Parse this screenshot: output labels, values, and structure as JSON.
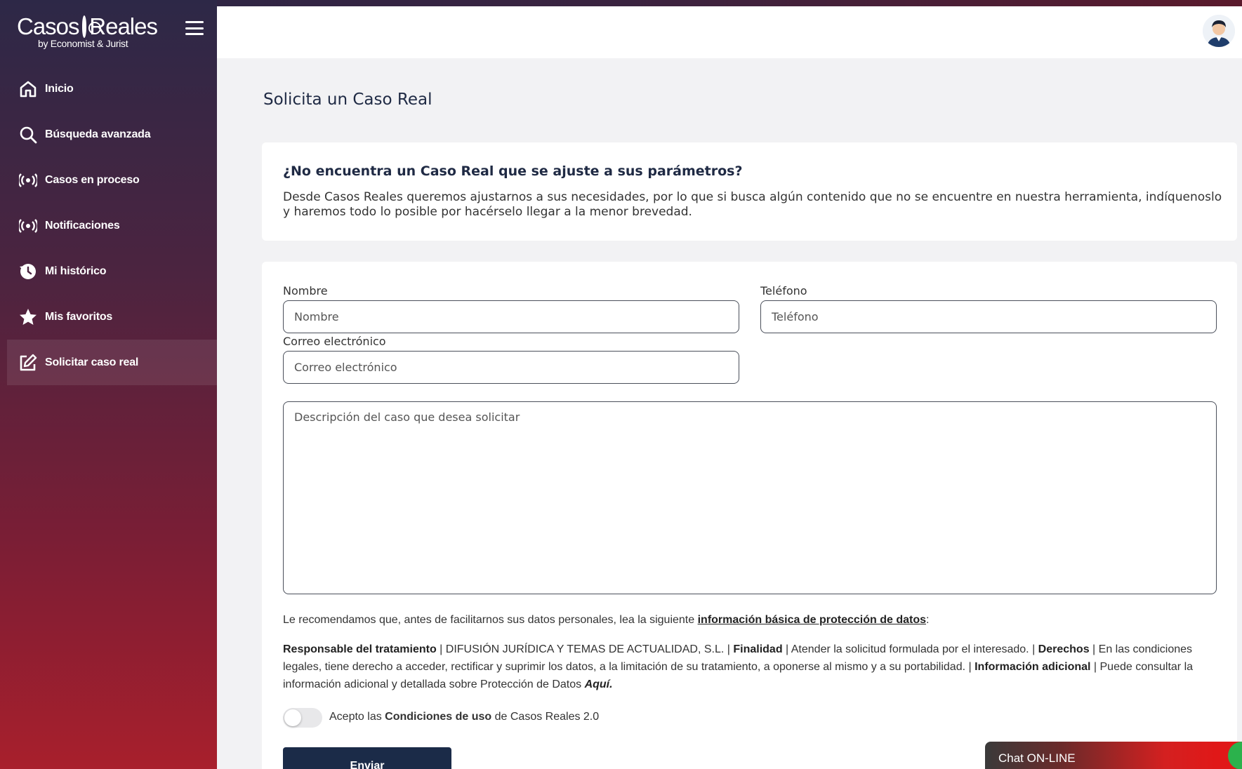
{
  "app": {
    "logo_main": "Casos",
    "logo_main2": "Reales",
    "logo_sub": "by Economist & Jurist"
  },
  "sidebar": {
    "items": [
      {
        "label": "Inicio",
        "icon": "home-icon"
      },
      {
        "label": "Búsqueda avanzada",
        "icon": "search-icon"
      },
      {
        "label": "Casos en proceso",
        "icon": "broadcast-icon"
      },
      {
        "label": "Notificaciones",
        "icon": "broadcast-icon"
      },
      {
        "label": "Mi histórico",
        "icon": "history-icon"
      },
      {
        "label": "Mis favoritos",
        "icon": "star-icon"
      },
      {
        "label": "Solicitar caso real",
        "icon": "edit-icon",
        "active": true
      }
    ]
  },
  "page": {
    "title": "Solicita un Caso Real"
  },
  "info": {
    "title": "¿No encuentra un Caso Real que se ajuste a sus parámetros?",
    "text": "Desde Casos Reales queremos ajustarnos a sus necesidades, por lo que si busca algún contenido que no se encuentre en nuestra herramienta, indíquenoslo y haremos todo lo posible por hacérselo llegar a la menor brevedad."
  },
  "form": {
    "name_label": "Nombre",
    "name_placeholder": "Nombre",
    "phone_label": "Teléfono",
    "phone_placeholder": "Teléfono",
    "email_label": "Correo electrónico",
    "email_placeholder": "Correo electrónico",
    "description_placeholder": "Descripción del caso que desea solicitar"
  },
  "legal": {
    "intro": "Le recomendamos que, antes de facilitarnos sus datos personales, lea la siguiente",
    "intro_link": "información básica de protección de datos",
    "intro_end": ":",
    "resp_label": "Responsable del tratamiento",
    "resp_text": " | DIFUSIÓN JURÍDICA Y TEMAS DE ACTUALIDAD, S.L. | ",
    "fin_label": "Finalidad",
    "fin_text": " | Atender la solicitud formulada por el interesado. | ",
    "der_label": "Derechos",
    "der_text": " | En las condiciones legales, tiene derecho a acceder, rectificar y suprimir los datos, a la limitación de su tratamiento, a oponerse al mismo y a su portabilidad. | ",
    "add_label": "Información adicional",
    "add_text": " | Puede consultar la información adicional y detallada sobre Protección de Datos ",
    "add_link": "Aquí."
  },
  "accept": {
    "prefix": "Acepto las ",
    "link": "Condiciones de uso",
    "suffix": " de Casos Reales 2.0"
  },
  "buttons": {
    "send": "Enviar"
  },
  "chat": {
    "label": "Chat ON-LINE"
  }
}
